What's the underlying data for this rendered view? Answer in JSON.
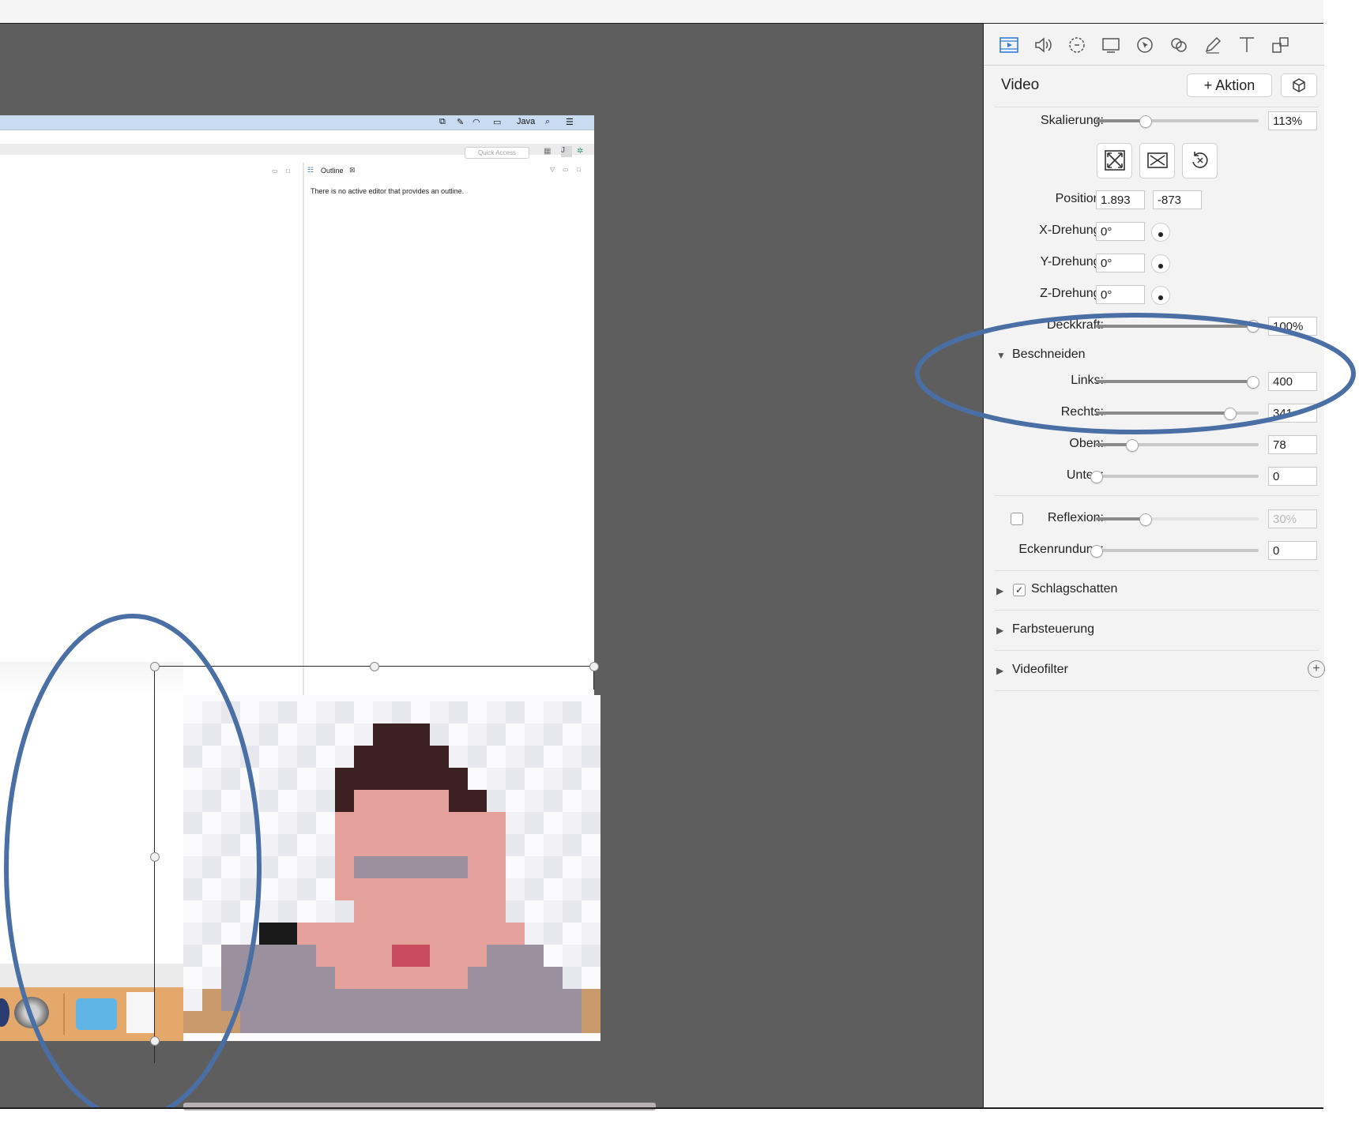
{
  "toolbar": {
    "tools": [
      "video-tool-icon",
      "audio-tool-icon",
      "animation-tool-icon",
      "screen-tool-icon",
      "cursor-tool-icon",
      "filter-tool-icon",
      "annotation-tool-icon",
      "text-tool-icon",
      "layout-tool-icon"
    ]
  },
  "inspector": {
    "title": "Video",
    "action_button": "+ Aktion",
    "scale_label": "Skalierung:",
    "scale_value": "113%",
    "scale_level": 0.3,
    "position_label": "Position:",
    "position_x": "1.893",
    "position_y": "-873",
    "x_rotation_label": "X-Drehung:",
    "x_rotation_value": "0°",
    "y_rotation_label": "Y-Drehung:",
    "y_rotation_value": "0°",
    "z_rotation_label": "Z-Drehung:",
    "z_rotation_value": "0°",
    "opacity_label": "Deckkraft:",
    "opacity_value": "100%",
    "crop_section": "Beschneiden",
    "left_label": "Links:",
    "left_value": "400",
    "left_level": 0.96,
    "right_label": "Rechts:",
    "right_value": "341",
    "right_level": 0.82,
    "top_label": "Oben:",
    "top_value": "78",
    "top_level": 0.22,
    "bottom_label": "Unten:",
    "bottom_value": "0",
    "bottom_level": 0.0,
    "reflection_label": "Reflexion:",
    "reflection_value": "30%",
    "reflection_level": 0.3,
    "corner_label": "Eckenrundung:",
    "corner_value": "0",
    "corner_level": 0.0,
    "shadow_label": "Schlagschatten",
    "shadow_checked": "✓",
    "color_label": "Farbsteuerung",
    "filter_label": "Videofilter"
  },
  "recording": {
    "menubar_lang": "Java",
    "quick_access": "Quick Access",
    "outline_tab": "Outline",
    "outline_message": "There is no active editor that provides an outline."
  },
  "colors": {
    "annotation_ellipse": "#4a6fa5",
    "canvas_bg": "#5e5e5e",
    "inspector_bg": "#f3f3f3"
  }
}
